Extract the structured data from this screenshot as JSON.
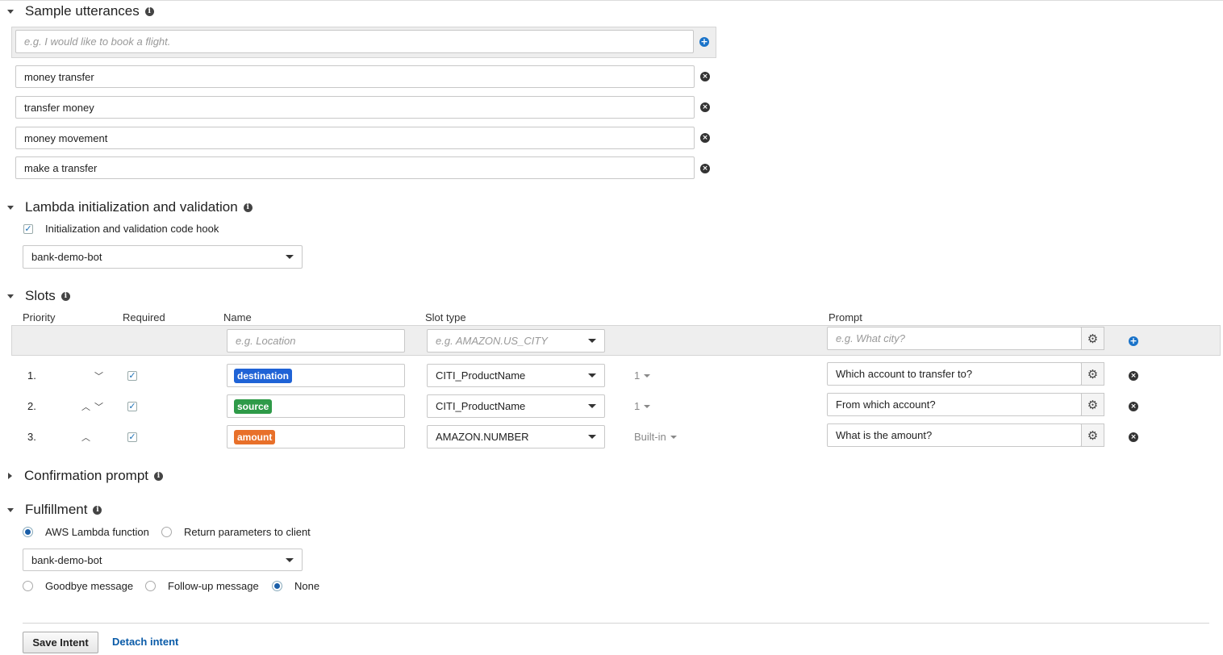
{
  "sample_utterances": {
    "title": "Sample utterances",
    "placeholder": "e.g. I would like to book a flight.",
    "items": [
      "money transfer",
      "transfer money",
      "money movement",
      "make a transfer"
    ]
  },
  "lambda_init": {
    "title": "Lambda initialization and validation",
    "checkbox_label": "Initialization and validation code hook",
    "function": "bank-demo-bot"
  },
  "slots": {
    "title": "Slots",
    "columns": {
      "priority": "Priority",
      "required": "Required",
      "name": "Name",
      "slot_type": "Slot type",
      "prompt": "Prompt"
    },
    "new_row": {
      "name_placeholder": "e.g. Location",
      "type_placeholder": "e.g. AMAZON.US_CITY",
      "prompt_placeholder": "e.g. What city?"
    },
    "rows": [
      {
        "priority": "1.",
        "name": "destination",
        "tag_color": "#1f63d6",
        "slot_type": "CITI_ProductName",
        "version": "1",
        "prompt": "Which account to transfer to?"
      },
      {
        "priority": "2.",
        "name": "source",
        "tag_color": "#2e9a48",
        "slot_type": "CITI_ProductName",
        "version": "1",
        "prompt": "From which account?"
      },
      {
        "priority": "3.",
        "name": "amount",
        "tag_color": "#e8702a",
        "slot_type": "AMAZON.NUMBER",
        "version": "Built-in",
        "prompt": "What is the amount?"
      }
    ]
  },
  "confirmation": {
    "title": "Confirmation prompt"
  },
  "fulfillment": {
    "title": "Fulfillment",
    "option_lambda": "AWS Lambda function",
    "option_client": "Return parameters to client",
    "function": "bank-demo-bot",
    "msg_goodbye": "Goodbye message",
    "msg_followup": "Follow-up message",
    "msg_none": "None"
  },
  "footer": {
    "save": "Save Intent",
    "detach": "Detach intent"
  },
  "colors": {
    "accent": "#1a73c9",
    "link": "#0a5ba8"
  }
}
